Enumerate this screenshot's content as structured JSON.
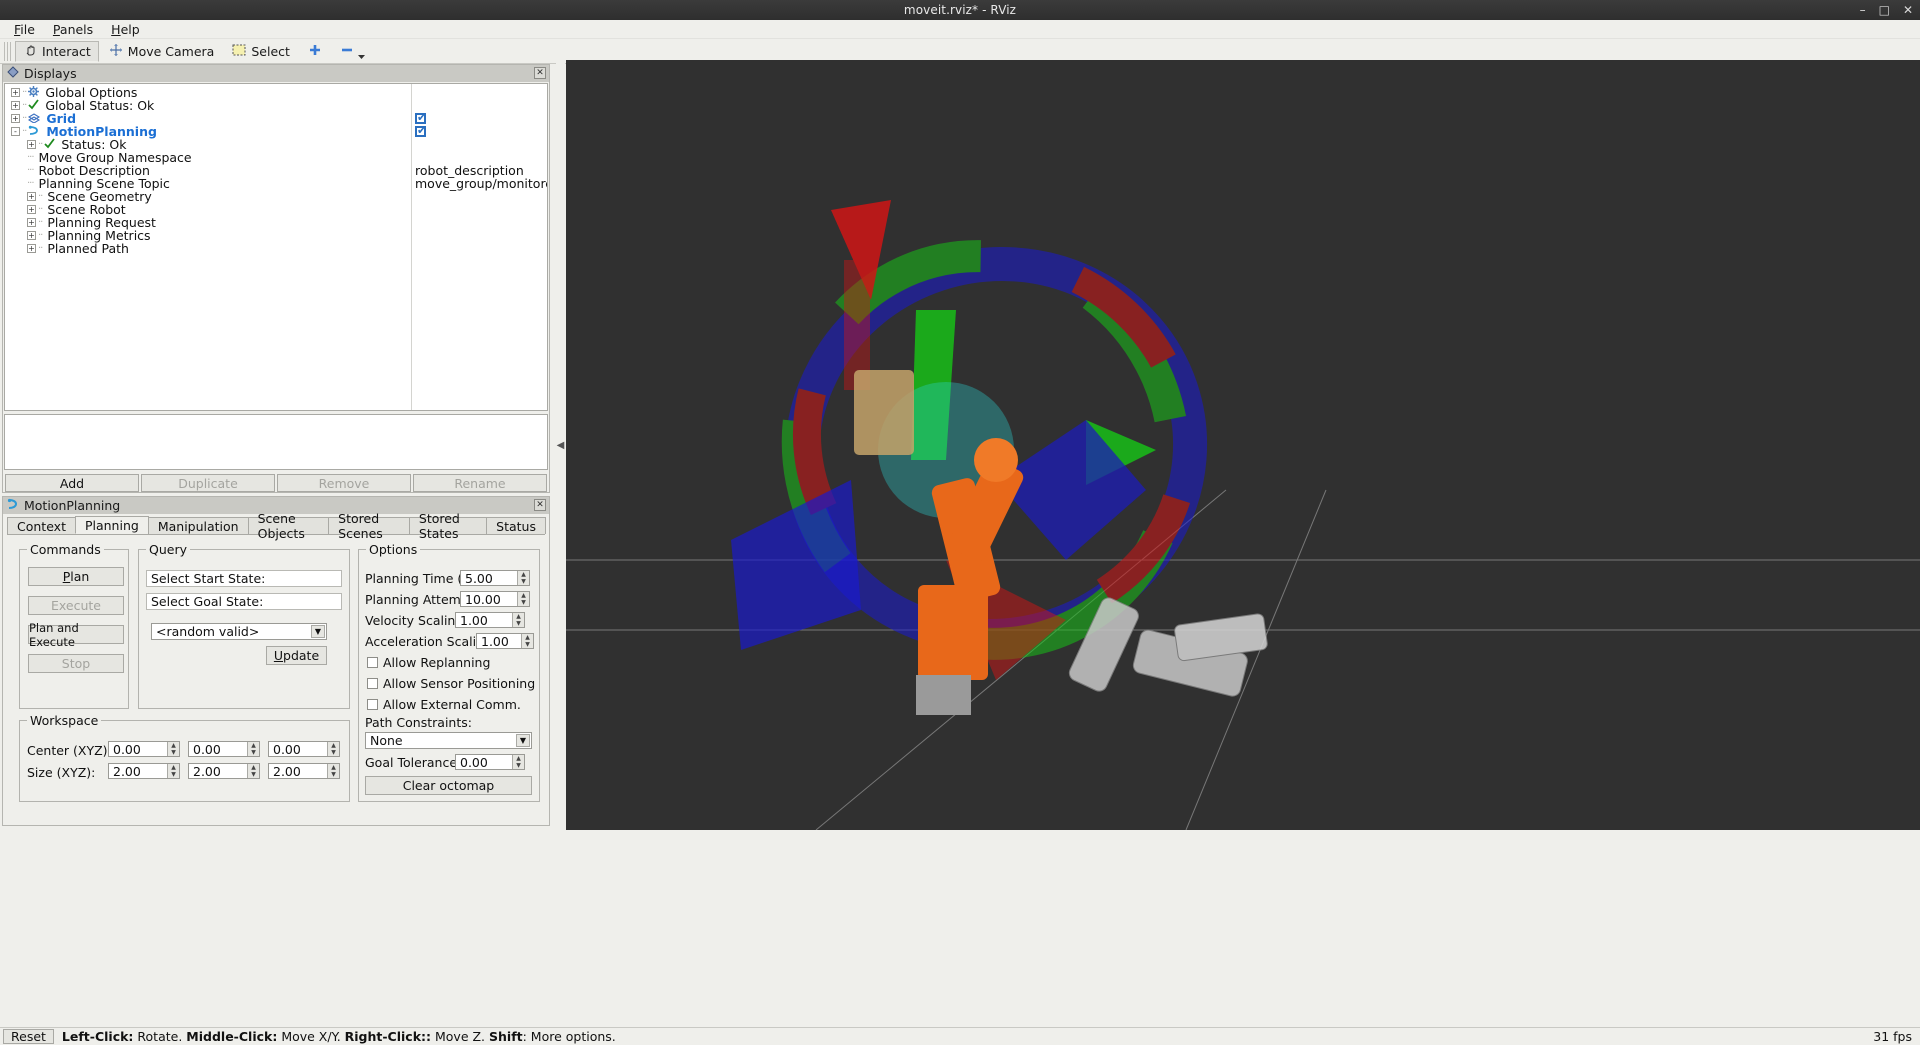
{
  "window": {
    "title": "moveit.rviz* - RViz",
    "minimize": "–",
    "maximize": "□",
    "close": "✕"
  },
  "menu": [
    {
      "label": "File"
    },
    {
      "label": "Panels"
    },
    {
      "label": "Help"
    }
  ],
  "toolbar": {
    "buttons": [
      {
        "label": "Interact",
        "icon": "hand-cursor-icon",
        "active": true
      },
      {
        "label": "Move Camera",
        "icon": "move-camera-icon",
        "active": false
      },
      {
        "label": "Select",
        "icon": "select-rect-icon",
        "active": false
      }
    ],
    "add_icon": "plus-icon",
    "remove_icon": "minus-icon",
    "overflow_icon": "chevron-down-icon"
  },
  "displays": {
    "panel_title": "Displays",
    "panel_icon": "displays-diamond-icon",
    "close_label": "✕",
    "tree": [
      {
        "label": "Global Options",
        "indent": 0,
        "expander": "+",
        "icon": "gear-icon",
        "bold": false,
        "value": ""
      },
      {
        "label": "Global Status: Ok",
        "indent": 0,
        "expander": "+",
        "icon": "check-icon",
        "bold": false,
        "value": ""
      },
      {
        "label": "Grid",
        "indent": 0,
        "expander": "+",
        "icon": "grid-icon",
        "bold": true,
        "checkbox": true
      },
      {
        "label": "MotionPlanning",
        "indent": 0,
        "expander": "-",
        "icon": "motion-planning-icon",
        "bold": true,
        "checkbox": true
      },
      {
        "label": "Status: Ok",
        "indent": 1,
        "expander": "+",
        "icon": "check-icon",
        "bold": false,
        "value": ""
      },
      {
        "label": "Move Group Namespace",
        "indent": 1,
        "expander": "leaf",
        "icon": "",
        "bold": false,
        "value": ""
      },
      {
        "label": "Robot Description",
        "indent": 1,
        "expander": "leaf",
        "icon": "",
        "bold": false,
        "value": "robot_description"
      },
      {
        "label": "Planning Scene Topic",
        "indent": 1,
        "expander": "leaf",
        "icon": "",
        "bold": false,
        "value": "move_group/monitored_p…"
      },
      {
        "label": "Scene Geometry",
        "indent": 1,
        "expander": "+",
        "icon": "",
        "bold": false,
        "value": ""
      },
      {
        "label": "Scene Robot",
        "indent": 1,
        "expander": "+",
        "icon": "",
        "bold": false,
        "value": ""
      },
      {
        "label": "Planning Request",
        "indent": 1,
        "expander": "+",
        "icon": "",
        "bold": false,
        "value": ""
      },
      {
        "label": "Planning Metrics",
        "indent": 1,
        "expander": "+",
        "icon": "",
        "bold": false,
        "value": ""
      },
      {
        "label": "Planned Path",
        "indent": 1,
        "expander": "+",
        "icon": "",
        "bold": false,
        "value": ""
      }
    ],
    "buttons": [
      {
        "label": "Add",
        "enabled": true
      },
      {
        "label": "Duplicate",
        "enabled": false
      },
      {
        "label": "Remove",
        "enabled": false
      },
      {
        "label": "Rename",
        "enabled": false
      }
    ]
  },
  "motion_planning": {
    "panel_title": "MotionPlanning",
    "panel_icon": "motion-planning-icon",
    "close_label": "✕",
    "tabs": [
      {
        "label": "Context",
        "selected": false
      },
      {
        "label": "Planning",
        "selected": true
      },
      {
        "label": "Manipulation",
        "selected": false
      },
      {
        "label": "Scene Objects",
        "selected": false
      },
      {
        "label": "Stored Scenes",
        "selected": false
      },
      {
        "label": "Stored States",
        "selected": false
      },
      {
        "label": "Status",
        "selected": false
      }
    ],
    "commands": {
      "title": "Commands",
      "plan": {
        "label": "Plan",
        "accel": "P",
        "enabled": true
      },
      "execute": {
        "label": "Execute",
        "enabled": false
      },
      "plan_and_execute": {
        "label": "Plan and Execute",
        "enabled": true
      },
      "stop": {
        "label": "Stop",
        "enabled": false
      }
    },
    "query": {
      "title": "Query",
      "select_start_state": "Select Start State:",
      "select_goal_state": "Select Goal State:",
      "goal_state_value": "<random valid>",
      "update_button": "Update",
      "update_accel": "U"
    },
    "options": {
      "title": "Options",
      "planning_time_label": "Planning Time (s):",
      "planning_time_value": "5.00",
      "planning_attempts_label": "Planning Attempts:",
      "planning_attempts_value": "10.00",
      "velocity_scaling_label": "Velocity Scaling:",
      "velocity_scaling_value": "1.00",
      "acceleration_scaling_label": "Acceleration Scaling:",
      "acceleration_scaling_value": "1.00",
      "allow_replanning": {
        "label": "Allow Replanning",
        "checked": false
      },
      "allow_sensor_positioning": {
        "label": "Allow Sensor Positioning",
        "checked": false
      },
      "allow_external_comm": {
        "label": "Allow External Comm.",
        "checked": false
      },
      "path_constraints_label": "Path Constraints:",
      "path_constraints_value": "None",
      "goal_tolerance_label": "Goal Tolerance:",
      "goal_tolerance_value": "0.00",
      "clear_octomap_button": "Clear octomap"
    },
    "workspace": {
      "title": "Workspace",
      "center_label": "Center (XYZ):",
      "center_values": [
        "0.00",
        "0.00",
        "0.00"
      ],
      "size_label": "Size (XYZ):",
      "size_values": [
        "2.00",
        "2.00",
        "2.00"
      ]
    }
  },
  "statusbar": {
    "reset_button": "Reset",
    "hint_parts": [
      {
        "text": "Left-Click:",
        "bold": true
      },
      {
        "text": " Rotate. ",
        "bold": false
      },
      {
        "text": "Middle-Click:",
        "bold": true
      },
      {
        "text": " Move X/Y. ",
        "bold": false
      },
      {
        "text": "Right-Click::",
        "bold": true
      },
      {
        "text": " Move Z. ",
        "bold": false
      },
      {
        "text": "Shift",
        "bold": true
      },
      {
        "text": ": More options.",
        "bold": false
      }
    ],
    "fps": "31 fps"
  },
  "viewport": {
    "background_color": "#303030",
    "grid_color": "#9a9a9a",
    "axis_red": "#d01616",
    "axis_green": "#18c018",
    "axis_blue": "#1a1ad0",
    "robot_orange": "#e8681a",
    "robot_gray": "#c8c8c8",
    "collapse_left_icon": "◀",
    "collapse_right_icon": "▶"
  }
}
